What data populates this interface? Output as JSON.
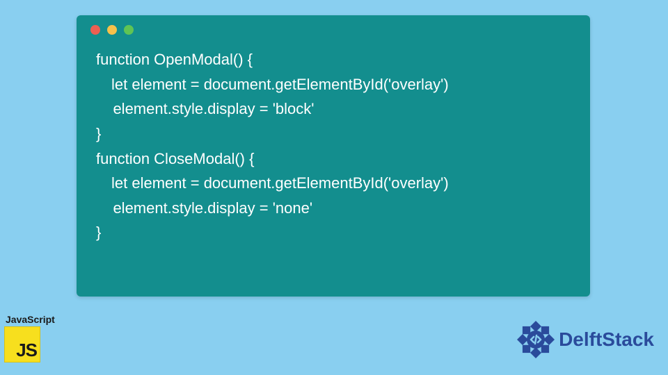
{
  "code_window": {
    "lines": [
      "function OpenModal() {",
      " let element = document.getElementById('overlay')",
      "    element.style.display = 'block'",
      "}",
      "function CloseModal() {",
      " let element = document.getElementById('overlay')",
      "    element.style.display = 'none'",
      "}"
    ]
  },
  "js_badge": {
    "label": "JavaScript",
    "logo_text": "JS"
  },
  "delft": {
    "text": "DelftStack"
  },
  "colors": {
    "page_bg": "#89cff0",
    "window_bg": "#138e8e",
    "code_text": "#ffffff",
    "js_logo_bg": "#f7df1e",
    "delft_brand": "#2a4b9b"
  }
}
